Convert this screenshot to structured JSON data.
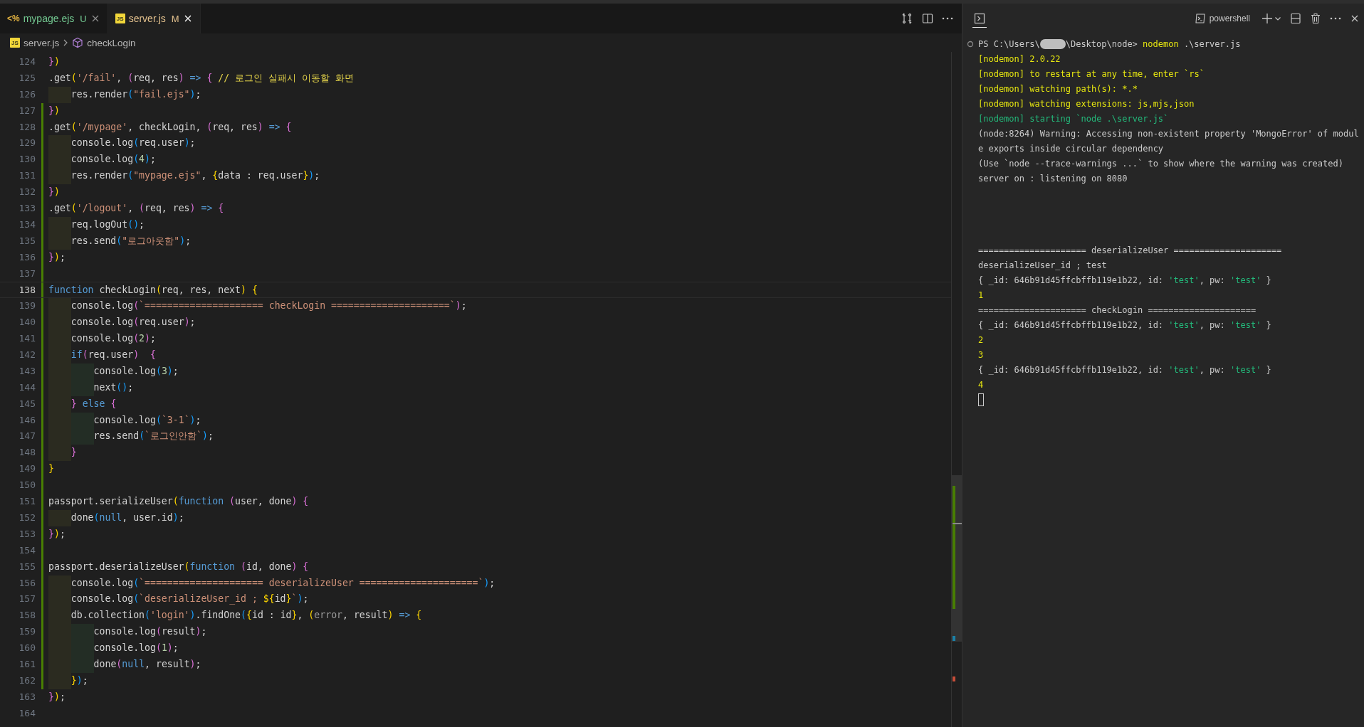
{
  "editor": {
    "tabs": [
      {
        "kind": "ejs",
        "icon_glyph": "<%",
        "label": "mypage.ejs",
        "git_badge": "U",
        "color": "#73c991",
        "selected": false
      },
      {
        "kind": "js",
        "icon_glyph": "JS",
        "label": "server.js",
        "git_badge": "M",
        "color": "#e2c08d",
        "selected": true
      }
    ],
    "breadcrumb": [
      {
        "kind": "file",
        "icon_glyph": "JS",
        "label": "server.js"
      },
      {
        "kind": "symbol",
        "label": "checkLogin"
      }
    ],
    "lines": [
      {
        "number": "124",
        "changed": false,
        "current": false,
        "tokens": [
          {
            "text": "}",
            "kind": "bracket2"
          },
          {
            "text": ")",
            "kind": "bracket1"
          }
        ]
      },
      {
        "number": "125",
        "changed": false,
        "current": false,
        "tokens": [
          {
            "text": ".get",
            "kind": "plain"
          },
          {
            "text": "(",
            "kind": "bracket1"
          },
          {
            "text": "'/fail'",
            "kind": "string"
          },
          {
            "text": ", ",
            "kind": "plain"
          },
          {
            "text": "(",
            "kind": "bracket2"
          },
          {
            "text": "req, res",
            "kind": "plain"
          },
          {
            "text": ")",
            "kind": "bracket2"
          },
          {
            "text": " =>",
            "kind": "keyword"
          },
          {
            "text": " {",
            "kind": "bracket2"
          },
          {
            "text": " // 로그인 실패시 이동할 화면",
            "kind": "comment"
          }
        ]
      },
      {
        "number": "126",
        "changed": false,
        "current": false,
        "tokens": [
          {
            "text": "    res.render",
            "kind": "plain"
          },
          {
            "text": "(",
            "kind": "bracket3"
          },
          {
            "text": "\"fail.ejs\"",
            "kind": "string"
          },
          {
            "text": ")",
            "kind": "bracket3"
          },
          {
            "text": ";",
            "kind": "plain"
          }
        ]
      },
      {
        "number": "127",
        "changed": true,
        "current": false,
        "tokens": [
          {
            "text": "}",
            "kind": "bracket2"
          },
          {
            "text": ")",
            "kind": "bracket1"
          }
        ]
      },
      {
        "number": "128",
        "changed": true,
        "current": false,
        "tokens": [
          {
            "text": ".get",
            "kind": "plain"
          },
          {
            "text": "(",
            "kind": "bracket1"
          },
          {
            "text": "'/mypage'",
            "kind": "string"
          },
          {
            "text": ", checkLogin, ",
            "kind": "plain"
          },
          {
            "text": "(",
            "kind": "bracket2"
          },
          {
            "text": "req, res",
            "kind": "plain"
          },
          {
            "text": ")",
            "kind": "bracket2"
          },
          {
            "text": " =>",
            "kind": "keyword"
          },
          {
            "text": " {",
            "kind": "bracket2"
          }
        ]
      },
      {
        "number": "129",
        "changed": true,
        "current": false,
        "tokens": [
          {
            "text": "    console.log",
            "kind": "plain"
          },
          {
            "text": "(",
            "kind": "bracket3"
          },
          {
            "text": "req.user",
            "kind": "plain"
          },
          {
            "text": ")",
            "kind": "bracket3"
          },
          {
            "text": ";",
            "kind": "plain"
          }
        ]
      },
      {
        "number": "130",
        "changed": true,
        "current": false,
        "tokens": [
          {
            "text": "    console.log",
            "kind": "plain"
          },
          {
            "text": "(",
            "kind": "bracket3"
          },
          {
            "text": "4",
            "kind": "number"
          },
          {
            "text": ")",
            "kind": "bracket3"
          },
          {
            "text": ";",
            "kind": "plain"
          }
        ]
      },
      {
        "number": "131",
        "changed": true,
        "current": false,
        "tokens": [
          {
            "text": "    res.render",
            "kind": "plain"
          },
          {
            "text": "(",
            "kind": "bracket3"
          },
          {
            "text": "\"mypage.ejs\"",
            "kind": "string"
          },
          {
            "text": ", ",
            "kind": "plain"
          },
          {
            "text": "{",
            "kind": "bracket1"
          },
          {
            "text": "data : req.user",
            "kind": "plain"
          },
          {
            "text": "}",
            "kind": "bracket1"
          },
          {
            "text": ")",
            "kind": "bracket3"
          },
          {
            "text": ";",
            "kind": "plain"
          }
        ]
      },
      {
        "number": "132",
        "changed": true,
        "current": false,
        "tokens": [
          {
            "text": "}",
            "kind": "bracket2"
          },
          {
            "text": ")",
            "kind": "bracket1"
          }
        ]
      },
      {
        "number": "133",
        "changed": true,
        "current": false,
        "tokens": [
          {
            "text": ".get",
            "kind": "plain"
          },
          {
            "text": "(",
            "kind": "bracket1"
          },
          {
            "text": "'/logout'",
            "kind": "string"
          },
          {
            "text": ", ",
            "kind": "plain"
          },
          {
            "text": "(",
            "kind": "bracket2"
          },
          {
            "text": "req, res",
            "kind": "plain"
          },
          {
            "text": ")",
            "kind": "bracket2"
          },
          {
            "text": " =>",
            "kind": "keyword"
          },
          {
            "text": " {",
            "kind": "bracket2"
          }
        ]
      },
      {
        "number": "134",
        "changed": true,
        "current": false,
        "tokens": [
          {
            "text": "    req.logOut",
            "kind": "plain"
          },
          {
            "text": "(",
            "kind": "bracket3"
          },
          {
            "text": ")",
            "kind": "bracket3"
          },
          {
            "text": ";",
            "kind": "plain"
          }
        ]
      },
      {
        "number": "135",
        "changed": true,
        "current": false,
        "tokens": [
          {
            "text": "    res.send",
            "kind": "plain"
          },
          {
            "text": "(",
            "kind": "bracket3"
          },
          {
            "text": "\"로그아웃함\"",
            "kind": "string"
          },
          {
            "text": ")",
            "kind": "bracket3"
          },
          {
            "text": ";",
            "kind": "plain"
          }
        ]
      },
      {
        "number": "136",
        "changed": true,
        "current": false,
        "tokens": [
          {
            "text": "}",
            "kind": "bracket2"
          },
          {
            "text": ")",
            "kind": "bracket1"
          },
          {
            "text": ";",
            "kind": "plain"
          }
        ]
      },
      {
        "number": "137",
        "changed": true,
        "current": false
      },
      {
        "number": "138",
        "changed": true,
        "current": true,
        "tokens": [
          {
            "text": "function",
            "kind": "keyword"
          },
          {
            "text": " checkLogin",
            "kind": "plain"
          },
          {
            "text": "(",
            "kind": "bracket1"
          },
          {
            "text": "req, res, next",
            "kind": "plain"
          },
          {
            "text": ")",
            "kind": "bracket1"
          },
          {
            "text": " {",
            "kind": "bracket1"
          }
        ]
      },
      {
        "number": "139",
        "changed": true,
        "current": false,
        "tokens": [
          {
            "text": "    console.log",
            "kind": "plain"
          },
          {
            "text": "(",
            "kind": "bracket2"
          },
          {
            "text": "`===================== checkLogin =====================`",
            "kind": "string"
          },
          {
            "text": ")",
            "kind": "bracket2"
          },
          {
            "text": ";",
            "kind": "plain"
          }
        ]
      },
      {
        "number": "140",
        "changed": true,
        "current": false,
        "tokens": [
          {
            "text": "    console.log",
            "kind": "plain"
          },
          {
            "text": "(",
            "kind": "bracket2"
          },
          {
            "text": "req.user",
            "kind": "plain"
          },
          {
            "text": ")",
            "kind": "bracket2"
          },
          {
            "text": ";",
            "kind": "plain"
          }
        ]
      },
      {
        "number": "141",
        "changed": true,
        "current": false,
        "tokens": [
          {
            "text": "    console.log",
            "kind": "plain"
          },
          {
            "text": "(",
            "kind": "bracket2"
          },
          {
            "text": "2",
            "kind": "number"
          },
          {
            "text": ")",
            "kind": "bracket2"
          },
          {
            "text": ";",
            "kind": "plain"
          }
        ]
      },
      {
        "number": "142",
        "changed": true,
        "current": false,
        "tokens": [
          {
            "text": "    if",
            "kind": "keyword"
          },
          {
            "text": "(",
            "kind": "bracket2"
          },
          {
            "text": "req.user",
            "kind": "plain"
          },
          {
            "text": ")",
            "kind": "bracket2"
          },
          {
            "text": "  {",
            "kind": "bracket2"
          }
        ]
      },
      {
        "number": "143",
        "changed": true,
        "current": false,
        "tokens": [
          {
            "text": "        console.log",
            "kind": "plain"
          },
          {
            "text": "(",
            "kind": "bracket3"
          },
          {
            "text": "3",
            "kind": "number"
          },
          {
            "text": ")",
            "kind": "bracket3"
          },
          {
            "text": ";",
            "kind": "plain"
          }
        ]
      },
      {
        "number": "144",
        "changed": true,
        "current": false,
        "tokens": [
          {
            "text": "        next",
            "kind": "plain"
          },
          {
            "text": "(",
            "kind": "bracket3"
          },
          {
            "text": ")",
            "kind": "bracket3"
          },
          {
            "text": ";",
            "kind": "plain"
          }
        ]
      },
      {
        "number": "145",
        "changed": true,
        "current": false,
        "tokens": [
          {
            "text": "    }",
            "kind": "bracket2"
          },
          {
            "text": " else",
            "kind": "keyword"
          },
          {
            "text": " {",
            "kind": "bracket2"
          }
        ]
      },
      {
        "number": "146",
        "changed": true,
        "current": false,
        "tokens": [
          {
            "text": "        console.log",
            "kind": "plain"
          },
          {
            "text": "(",
            "kind": "bracket3"
          },
          {
            "text": "`3-1`",
            "kind": "string"
          },
          {
            "text": ")",
            "kind": "bracket3"
          },
          {
            "text": ";",
            "kind": "plain"
          }
        ]
      },
      {
        "number": "147",
        "changed": true,
        "current": false,
        "tokens": [
          {
            "text": "        res.send",
            "kind": "plain"
          },
          {
            "text": "(",
            "kind": "bracket3"
          },
          {
            "text": "`로그인안함`",
            "kind": "string"
          },
          {
            "text": ")",
            "kind": "bracket3"
          },
          {
            "text": ";",
            "kind": "plain"
          }
        ]
      },
      {
        "number": "148",
        "changed": true,
        "current": false,
        "tokens": [
          {
            "text": "    }",
            "kind": "bracket2"
          }
        ]
      },
      {
        "number": "149",
        "changed": true,
        "current": false,
        "tokens": [
          {
            "text": "}",
            "kind": "bracket1"
          }
        ]
      },
      {
        "number": "150",
        "changed": true,
        "current": false
      },
      {
        "number": "151",
        "changed": true,
        "current": false,
        "tokens": [
          {
            "text": "passport.serializeUser",
            "kind": "plain"
          },
          {
            "text": "(",
            "kind": "bracket1"
          },
          {
            "text": "function",
            "kind": "keyword"
          },
          {
            "text": " (",
            "kind": "bracket2"
          },
          {
            "text": "user, done",
            "kind": "plain"
          },
          {
            "text": ")",
            "kind": "bracket2"
          },
          {
            "text": " {",
            "kind": "bracket2"
          }
        ]
      },
      {
        "number": "152",
        "changed": true,
        "current": false,
        "tokens": [
          {
            "text": "    done",
            "kind": "plain"
          },
          {
            "text": "(",
            "kind": "bracket3"
          },
          {
            "text": "null",
            "kind": "keyword"
          },
          {
            "text": ", user.id",
            "kind": "plain"
          },
          {
            "text": ")",
            "kind": "bracket3"
          },
          {
            "text": ";",
            "kind": "plain"
          }
        ]
      },
      {
        "number": "153",
        "changed": true,
        "current": false,
        "tokens": [
          {
            "text": "}",
            "kind": "bracket2"
          },
          {
            "text": ")",
            "kind": "bracket1"
          },
          {
            "text": ";",
            "kind": "plain"
          }
        ]
      },
      {
        "number": "154",
        "changed": true,
        "current": false
      },
      {
        "number": "155",
        "changed": true,
        "current": false,
        "tokens": [
          {
            "text": "passport.deserializeUser",
            "kind": "plain"
          },
          {
            "text": "(",
            "kind": "bracket1"
          },
          {
            "text": "function",
            "kind": "keyword"
          },
          {
            "text": " (",
            "kind": "bracket2"
          },
          {
            "text": "id, done",
            "kind": "plain"
          },
          {
            "text": ")",
            "kind": "bracket2"
          },
          {
            "text": " {",
            "kind": "bracket2"
          }
        ]
      },
      {
        "number": "156",
        "changed": true,
        "current": false,
        "tokens": [
          {
            "text": "    console.log",
            "kind": "plain"
          },
          {
            "text": "(",
            "kind": "bracket3"
          },
          {
            "text": "`===================== deserializeUser =====================`",
            "kind": "string"
          },
          {
            "text": ")",
            "kind": "bracket3"
          },
          {
            "text": ";",
            "kind": "plain"
          }
        ]
      },
      {
        "number": "157",
        "changed": true,
        "current": false,
        "tokens": [
          {
            "text": "    console.log",
            "kind": "plain"
          },
          {
            "text": "(",
            "kind": "bracket3"
          },
          {
            "text": "`deserializeUser_id ; ",
            "kind": "string"
          },
          {
            "text": "${",
            "kind": "bracket1"
          },
          {
            "text": "id",
            "kind": "plain"
          },
          {
            "text": "}",
            "kind": "bracket1"
          },
          {
            "text": "`",
            "kind": "string"
          },
          {
            "text": ")",
            "kind": "bracket3"
          },
          {
            "text": ";",
            "kind": "plain"
          }
        ]
      },
      {
        "number": "158",
        "changed": true,
        "current": false,
        "tokens": [
          {
            "text": "    db.collection",
            "kind": "plain"
          },
          {
            "text": "(",
            "kind": "bracket3"
          },
          {
            "text": "'login'",
            "kind": "string"
          },
          {
            "text": ")",
            "kind": "bracket3"
          },
          {
            "text": ".findOne",
            "kind": "plain"
          },
          {
            "text": "(",
            "kind": "bracket3"
          },
          {
            "text": "{",
            "kind": "bracket1"
          },
          {
            "text": "id : id",
            "kind": "plain"
          },
          {
            "text": "}",
            "kind": "bracket1"
          },
          {
            "text": ", ",
            "kind": "plain"
          },
          {
            "text": "(",
            "kind": "bracket1"
          },
          {
            "text": "error",
            "kind": "unused"
          },
          {
            "text": ", result",
            "kind": "plain"
          },
          {
            "text": ")",
            "kind": "bracket1"
          },
          {
            "text": " =>",
            "kind": "keyword"
          },
          {
            "text": " {",
            "kind": "bracket1"
          }
        ]
      },
      {
        "number": "159",
        "changed": true,
        "current": false,
        "tokens": [
          {
            "text": "        console.log",
            "kind": "plain"
          },
          {
            "text": "(",
            "kind": "bracket2"
          },
          {
            "text": "result",
            "kind": "plain"
          },
          {
            "text": ")",
            "kind": "bracket2"
          },
          {
            "text": ";",
            "kind": "plain"
          }
        ]
      },
      {
        "number": "160",
        "changed": true,
        "current": false,
        "tokens": [
          {
            "text": "        console.log",
            "kind": "plain"
          },
          {
            "text": "(",
            "kind": "bracket2"
          },
          {
            "text": "1",
            "kind": "number"
          },
          {
            "text": ")",
            "kind": "bracket2"
          },
          {
            "text": ";",
            "kind": "plain"
          }
        ]
      },
      {
        "number": "161",
        "changed": true,
        "current": false,
        "tokens": [
          {
            "text": "        done",
            "kind": "plain"
          },
          {
            "text": "(",
            "kind": "bracket2"
          },
          {
            "text": "null",
            "kind": "keyword"
          },
          {
            "text": ", result",
            "kind": "plain"
          },
          {
            "text": ")",
            "kind": "bracket2"
          },
          {
            "text": ";",
            "kind": "plain"
          }
        ]
      },
      {
        "number": "162",
        "changed": true,
        "current": false,
        "tokens": [
          {
            "text": "    }",
            "kind": "bracket1"
          },
          {
            "text": ")",
            "kind": "bracket3"
          },
          {
            "text": ";",
            "kind": "plain"
          }
        ]
      },
      {
        "number": "163",
        "changed": false,
        "current": false,
        "tokens": [
          {
            "text": "}",
            "kind": "bracket2"
          },
          {
            "text": ")",
            "kind": "bracket1"
          },
          {
            "text": ";",
            "kind": "plain"
          }
        ]
      },
      {
        "number": "164",
        "changed": false,
        "current": false
      }
    ]
  },
  "terminal": {
    "shell_label": "powershell",
    "blocks": [
      [
        {
          "kind": "prompt",
          "tokens": [
            {
              "text": "PS C:\\Users\\",
              "kind": "plain"
            },
            {
              "kind": "redacted"
            },
            {
              "text": "\\Desktop\\node> ",
              "kind": "plain"
            },
            {
              "text": "nodemon",
              "kind": "warn"
            },
            {
              "text": " .\\server.js",
              "kind": "plain"
            }
          ]
        },
        {
          "kind": "output",
          "tokens": [
            {
              "text": "[nodemon] 2.0.22",
              "kind": "warn"
            }
          ]
        },
        {
          "kind": "output",
          "tokens": [
            {
              "text": "[nodemon] to restart at any time, enter `rs`",
              "kind": "warn"
            }
          ]
        },
        {
          "kind": "output",
          "tokens": [
            {
              "text": "[nodemon] watching path(s): *.*",
              "kind": "warn"
            }
          ]
        },
        {
          "kind": "output",
          "tokens": [
            {
              "text": "[nodemon] watching extensions: js,mjs,json",
              "kind": "warn"
            }
          ]
        },
        {
          "kind": "output",
          "tokens": [
            {
              "text": "[nodemon] starting `node .\\server.js`",
              "kind": "success"
            }
          ]
        },
        {
          "kind": "output",
          "tokens": [
            {
              "text": "(node:8264) Warning: Accessing non-existent property 'MongoError' of modul",
              "kind": "plain"
            }
          ]
        },
        {
          "kind": "output",
          "tokens": [
            {
              "text": "e exports inside circular dependency",
              "kind": "plain"
            }
          ]
        },
        {
          "kind": "output",
          "tokens": [
            {
              "text": "(Use `node --trace-warnings ...` to show where the warning was created)",
              "kind": "plain"
            }
          ]
        },
        {
          "kind": "output",
          "tokens": [
            {
              "text": "server on : listening on 8080",
              "kind": "plain"
            }
          ]
        }
      ],
      [
        {
          "kind": "output",
          "tokens": [
            {
              "text": "===================== deserializeUser =====================",
              "kind": "plain"
            }
          ]
        },
        {
          "kind": "output",
          "tokens": [
            {
              "text": "deserializeUser_id ; test",
              "kind": "plain"
            }
          ]
        },
        {
          "kind": "output",
          "tokens": [
            {
              "text": "{ _id: 646b91d45ffcbffb119e1b22, id: ",
              "kind": "plain"
            },
            {
              "text": "'test'",
              "kind": "success"
            },
            {
              "text": ", pw: ",
              "kind": "plain"
            },
            {
              "text": "'test'",
              "kind": "success"
            },
            {
              "text": " }",
              "kind": "plain"
            }
          ]
        },
        {
          "kind": "output",
          "tokens": [
            {
              "text": "1",
              "kind": "warn"
            }
          ]
        },
        {
          "kind": "output",
          "tokens": [
            {
              "text": "===================== checkLogin =====================",
              "kind": "plain"
            }
          ]
        },
        {
          "kind": "output",
          "tokens": [
            {
              "text": "{ _id: 646b91d45ffcbffb119e1b22, id: ",
              "kind": "plain"
            },
            {
              "text": "'test'",
              "kind": "success"
            },
            {
              "text": ", pw: ",
              "kind": "plain"
            },
            {
              "text": "'test'",
              "kind": "success"
            },
            {
              "text": " }",
              "kind": "plain"
            }
          ]
        },
        {
          "kind": "output",
          "tokens": [
            {
              "text": "2",
              "kind": "warn"
            }
          ]
        },
        {
          "kind": "output",
          "tokens": [
            {
              "text": "3",
              "kind": "warn"
            }
          ]
        },
        {
          "kind": "output",
          "tokens": [
            {
              "text": "{ _id: 646b91d45ffcbffb119e1b22, id: ",
              "kind": "plain"
            },
            {
              "text": "'test'",
              "kind": "success"
            },
            {
              "text": ", pw: ",
              "kind": "plain"
            },
            {
              "text": "'test'",
              "kind": "success"
            },
            {
              "text": " }",
              "kind": "plain"
            }
          ]
        },
        {
          "kind": "output",
          "tokens": [
            {
              "text": "4",
              "kind": "warn"
            }
          ]
        },
        {
          "kind": "cursor"
        }
      ]
    ]
  }
}
